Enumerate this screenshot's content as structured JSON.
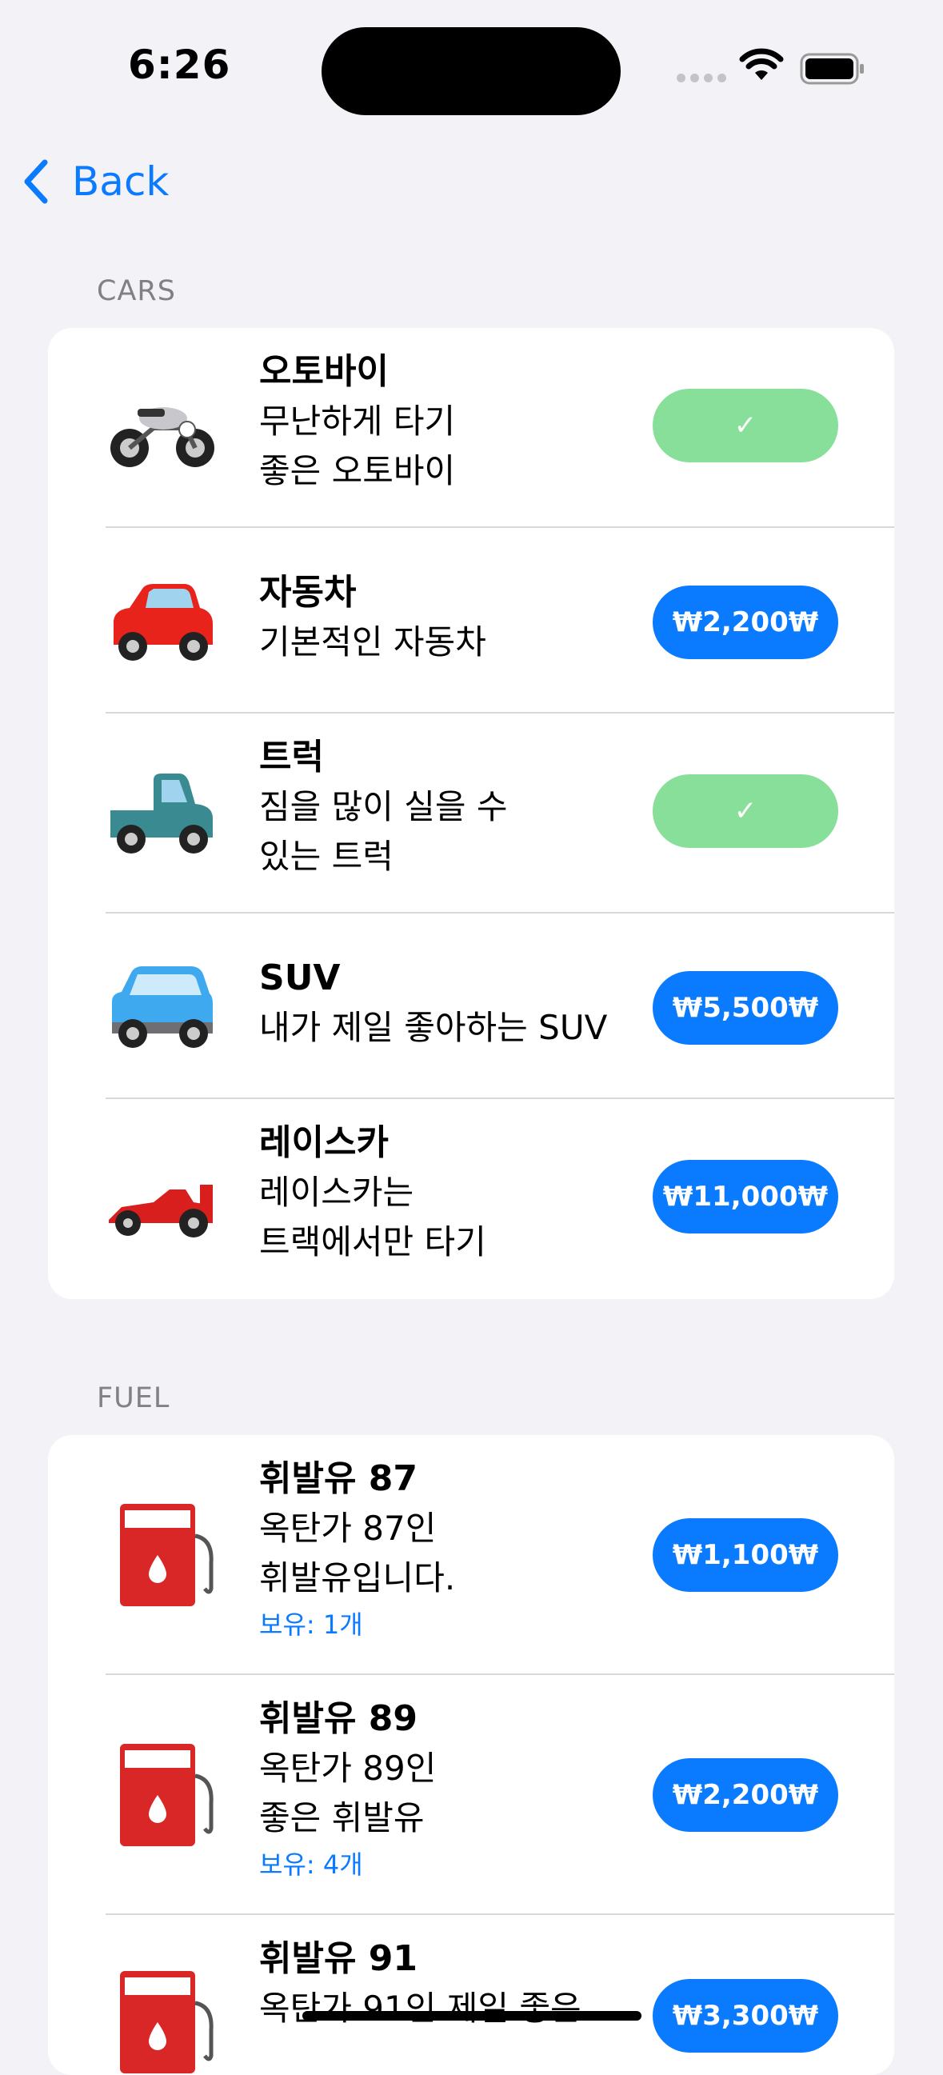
{
  "status_bar": {
    "time": "6:26"
  },
  "nav": {
    "back_label": "Back"
  },
  "colors": {
    "accent": "#0A7AFF",
    "owned_green": "#87DF9A",
    "background": "#F2F2F7"
  },
  "sections": {
    "cars": {
      "header": "CARS",
      "items": [
        {
          "icon": "motorcycle-emoji",
          "title": "오토바이",
          "desc_line1": "무난하게 타기",
          "desc_line2": "좋은 오토바이",
          "button": "✓",
          "state": "owned"
        },
        {
          "icon": "red-car-emoji",
          "title": "자동차",
          "desc_line1": "기본적인 자동차",
          "desc_line2": "",
          "button": "₩2,200₩",
          "state": "buy"
        },
        {
          "icon": "pickup-truck-emoji",
          "title": "트럭",
          "desc_line1": "짐을 많이 실을 수",
          "desc_line2": "있는 트럭",
          "button": "✓",
          "state": "owned"
        },
        {
          "icon": "suv-emoji",
          "title": "SUV",
          "desc_line1": "내가 제일 좋아하는 SUV",
          "desc_line2": "",
          "button": "₩5,500₩",
          "state": "buy"
        },
        {
          "icon": "racing-car-emoji",
          "title": "레이스카",
          "desc_line1": "레이스카는",
          "desc_line2": "트랙에서만 타기",
          "button": "₩11,000₩",
          "state": "buy"
        }
      ]
    },
    "fuel": {
      "header": "FUEL",
      "items": [
        {
          "icon": "fuel-pump-emoji",
          "title": "휘발유 87",
          "desc_line1": "옥탄가 87인",
          "desc_line2": "휘발유입니다.",
          "owned": "보유: 1개",
          "button": "₩1,100₩"
        },
        {
          "icon": "fuel-pump-emoji",
          "title": "휘발유 89",
          "desc_line1": "옥탄가 89인",
          "desc_line2": "좋은 휘발유",
          "owned": "보유: 4개",
          "button": "₩2,200₩"
        },
        {
          "icon": "fuel-pump-emoji",
          "title": "휘발유 91",
          "desc_line1": "옥탄가 91인 제일 좋은",
          "desc_line2": "",
          "owned": "",
          "button": "₩3,300₩"
        }
      ]
    }
  }
}
